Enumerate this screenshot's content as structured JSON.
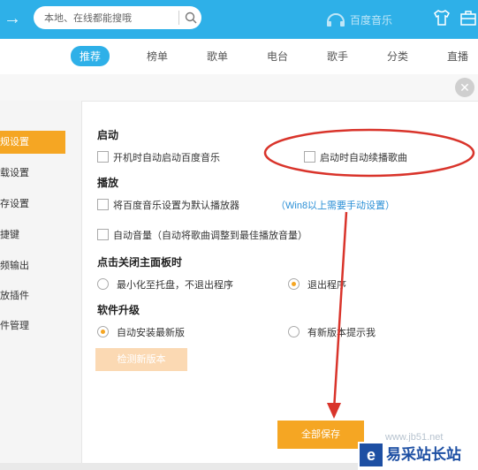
{
  "search": {
    "placeholder": "本地、在线都能搜哦"
  },
  "brand": {
    "name": "百度音乐"
  },
  "tabs": [
    {
      "label": "推荐",
      "active": true
    },
    {
      "label": "榜单"
    },
    {
      "label": "歌单"
    },
    {
      "label": "电台"
    },
    {
      "label": "歌手"
    },
    {
      "label": "分类"
    },
    {
      "label": "直播"
    }
  ],
  "sidebar": {
    "items": [
      {
        "label": "规设置",
        "active": true
      },
      {
        "label": "载设置"
      },
      {
        "label": "存设置"
      },
      {
        "label": "捷键"
      },
      {
        "label": "频输出"
      },
      {
        "label": "放插件"
      },
      {
        "label": "件管理"
      }
    ]
  },
  "sections": {
    "startup": {
      "title": "启动",
      "opt1": "开机时自动启动百度音乐",
      "opt2": "启动时自动续播歌曲"
    },
    "play": {
      "title": "播放",
      "opt1": "将百度音乐设置为默认播放器",
      "link": "（Win8以上需要手动设置）",
      "opt2": "自动音量（自动将歌曲调整到最佳播放音量）"
    },
    "close": {
      "title": "点击关闭主面板时",
      "opt1": "最小化至托盘，不退出程序",
      "opt2": "退出程序",
      "selected": "opt2"
    },
    "upgrade": {
      "title": "软件升级",
      "opt1": "自动安装最新版",
      "opt2": "有新版本提示我",
      "selected": "opt1"
    }
  },
  "buttons": {
    "check": "检测新版本",
    "save": "全部保存"
  },
  "watermark": {
    "url": "www.jb51.net",
    "text": "易采站长站"
  },
  "colors": {
    "accent": "#2eb0e8",
    "orange": "#f5a623",
    "annotation": "#d9342b"
  }
}
